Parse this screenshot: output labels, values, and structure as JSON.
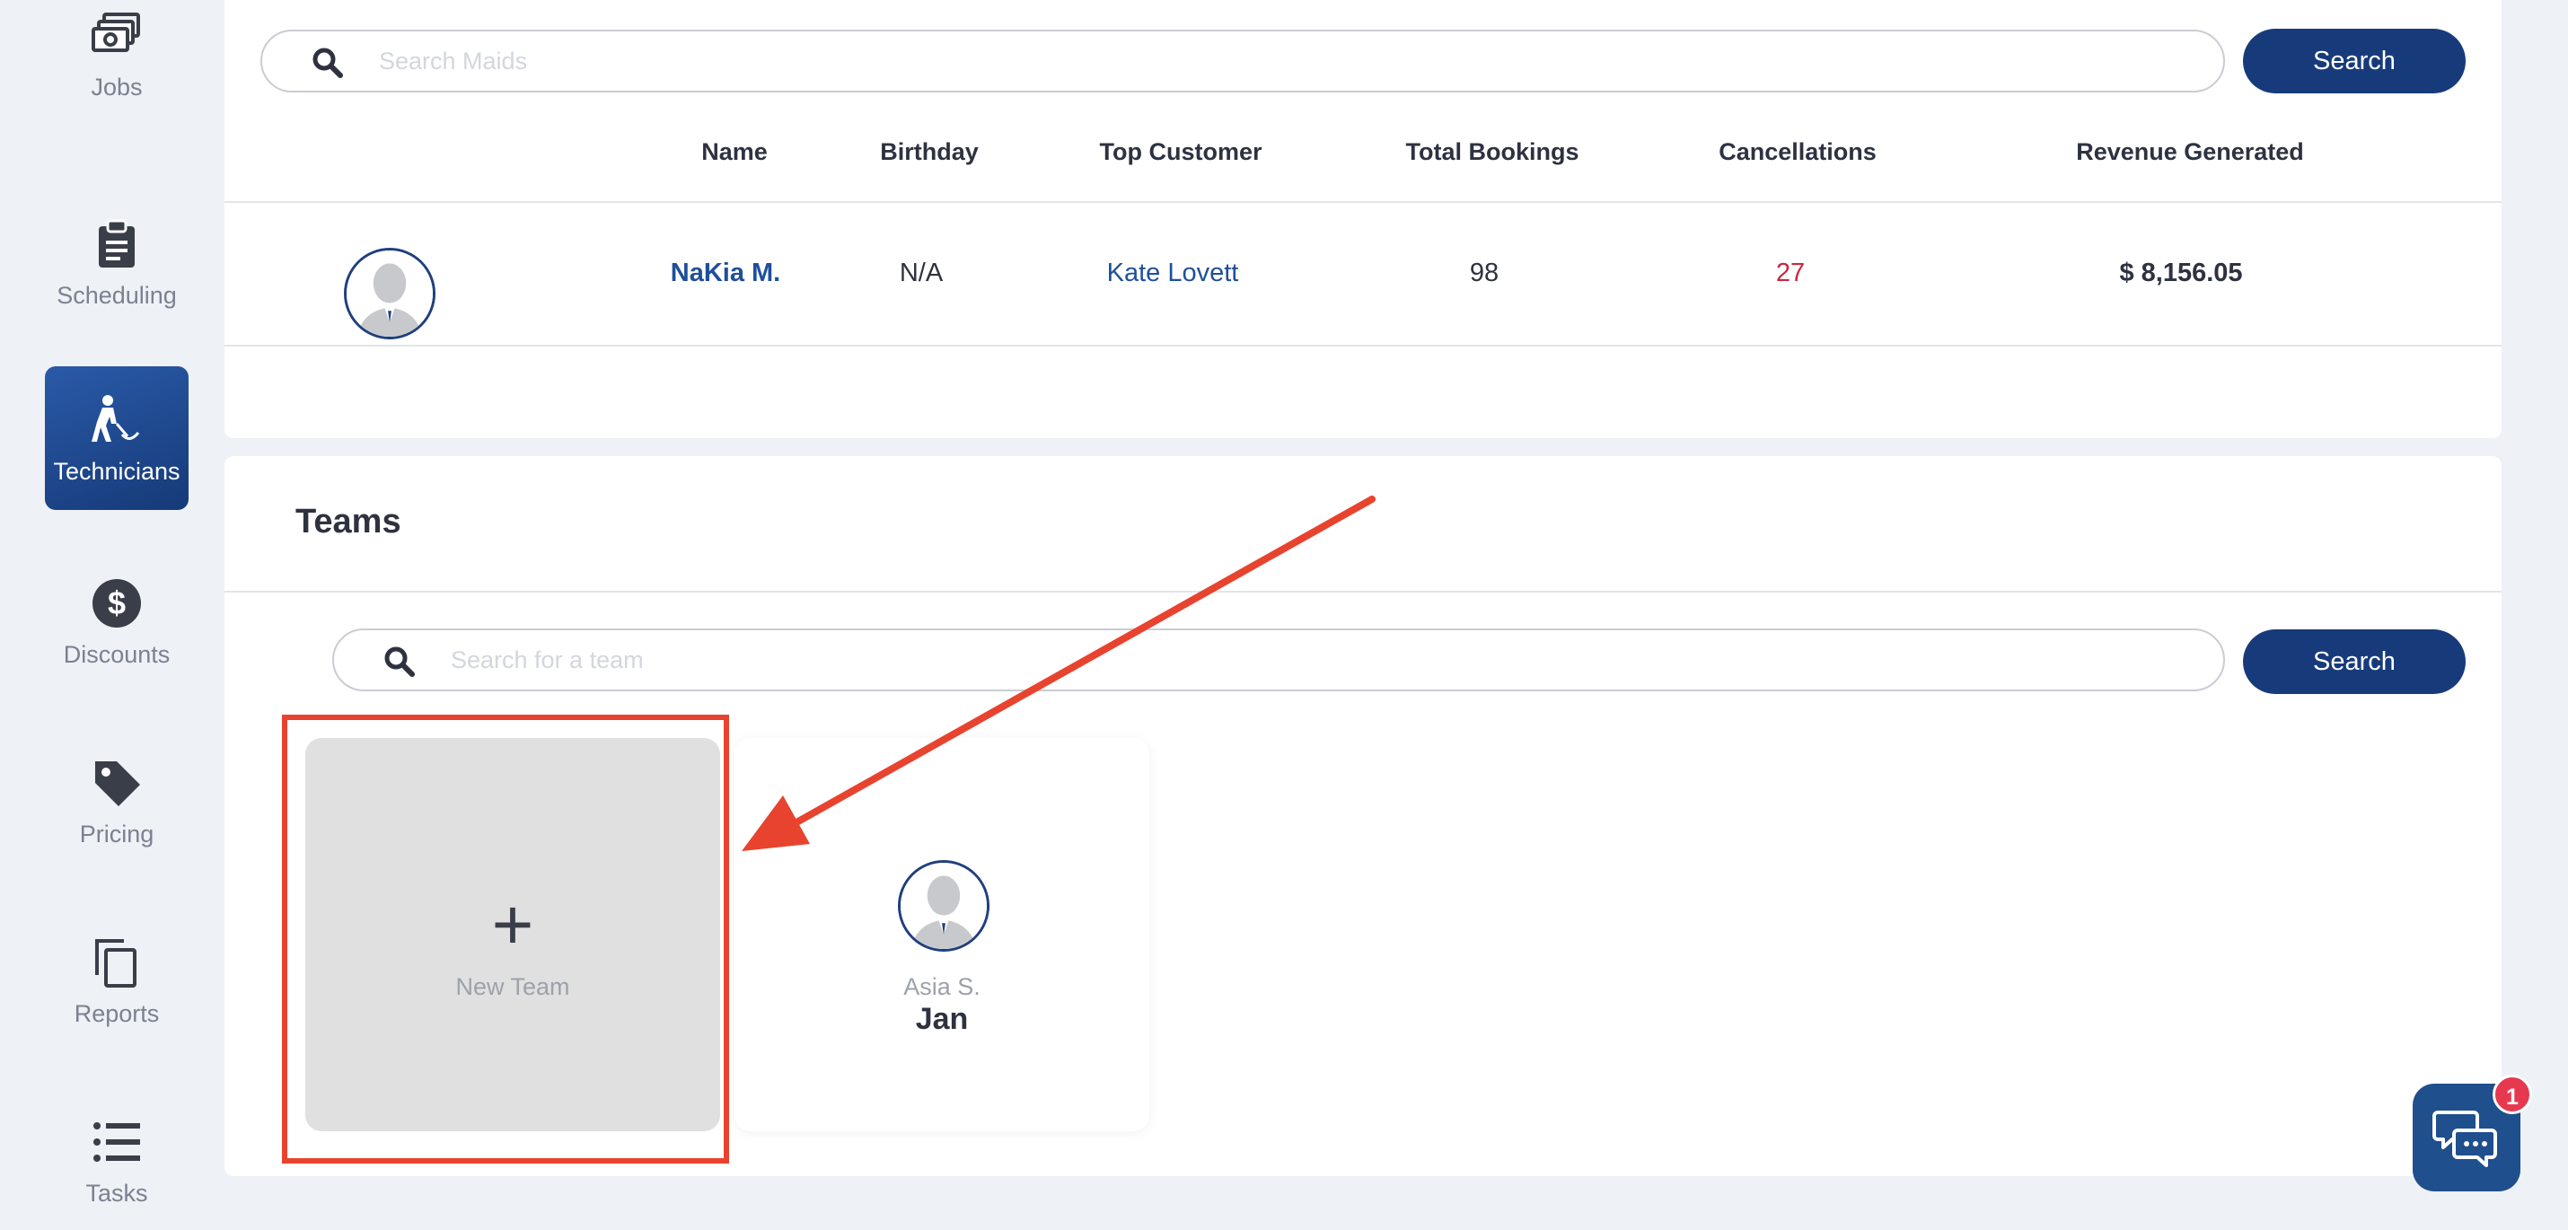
{
  "sidebar": {
    "items": [
      {
        "label": "Jobs",
        "icon": "jobs-icon"
      },
      {
        "label": "Scheduling",
        "icon": "clipboard-icon"
      },
      {
        "label": "Technicians",
        "icon": "technician-icon",
        "active": true
      },
      {
        "label": "Discounts",
        "icon": "dollar-icon"
      },
      {
        "label": "Pricing",
        "icon": "tag-icon"
      },
      {
        "label": "Reports",
        "icon": "copy-icon"
      },
      {
        "label": "Tasks",
        "icon": "list-icon"
      }
    ]
  },
  "maids": {
    "search": {
      "placeholder": "Search Maids",
      "value": "",
      "button_label": "Search"
    },
    "columns": [
      "Name",
      "Birthday",
      "Top Customer",
      "Total Bookings",
      "Cancellations",
      "Revenue Generated"
    ],
    "rows": [
      {
        "name": "NaKia M.",
        "birthday": "N/A",
        "top_customer": "Kate Lovett",
        "total_bookings": "98",
        "cancellations": "27",
        "revenue": "$ 8,156.05"
      }
    ]
  },
  "teams": {
    "title": "Teams",
    "search": {
      "placeholder": "Search for a team",
      "value": "",
      "button_label": "Search"
    },
    "new_team": {
      "plus": "+",
      "label": "New Team"
    },
    "cards": [
      {
        "member": "Asia S.",
        "name": "Jan"
      }
    ]
  },
  "chat": {
    "badge_count": "1"
  },
  "colors": {
    "primary": "#173b7a",
    "link": "#1f4f9a",
    "cancellations": "#c8283c",
    "annotation": "#e8432e",
    "badge": "#e63950"
  }
}
